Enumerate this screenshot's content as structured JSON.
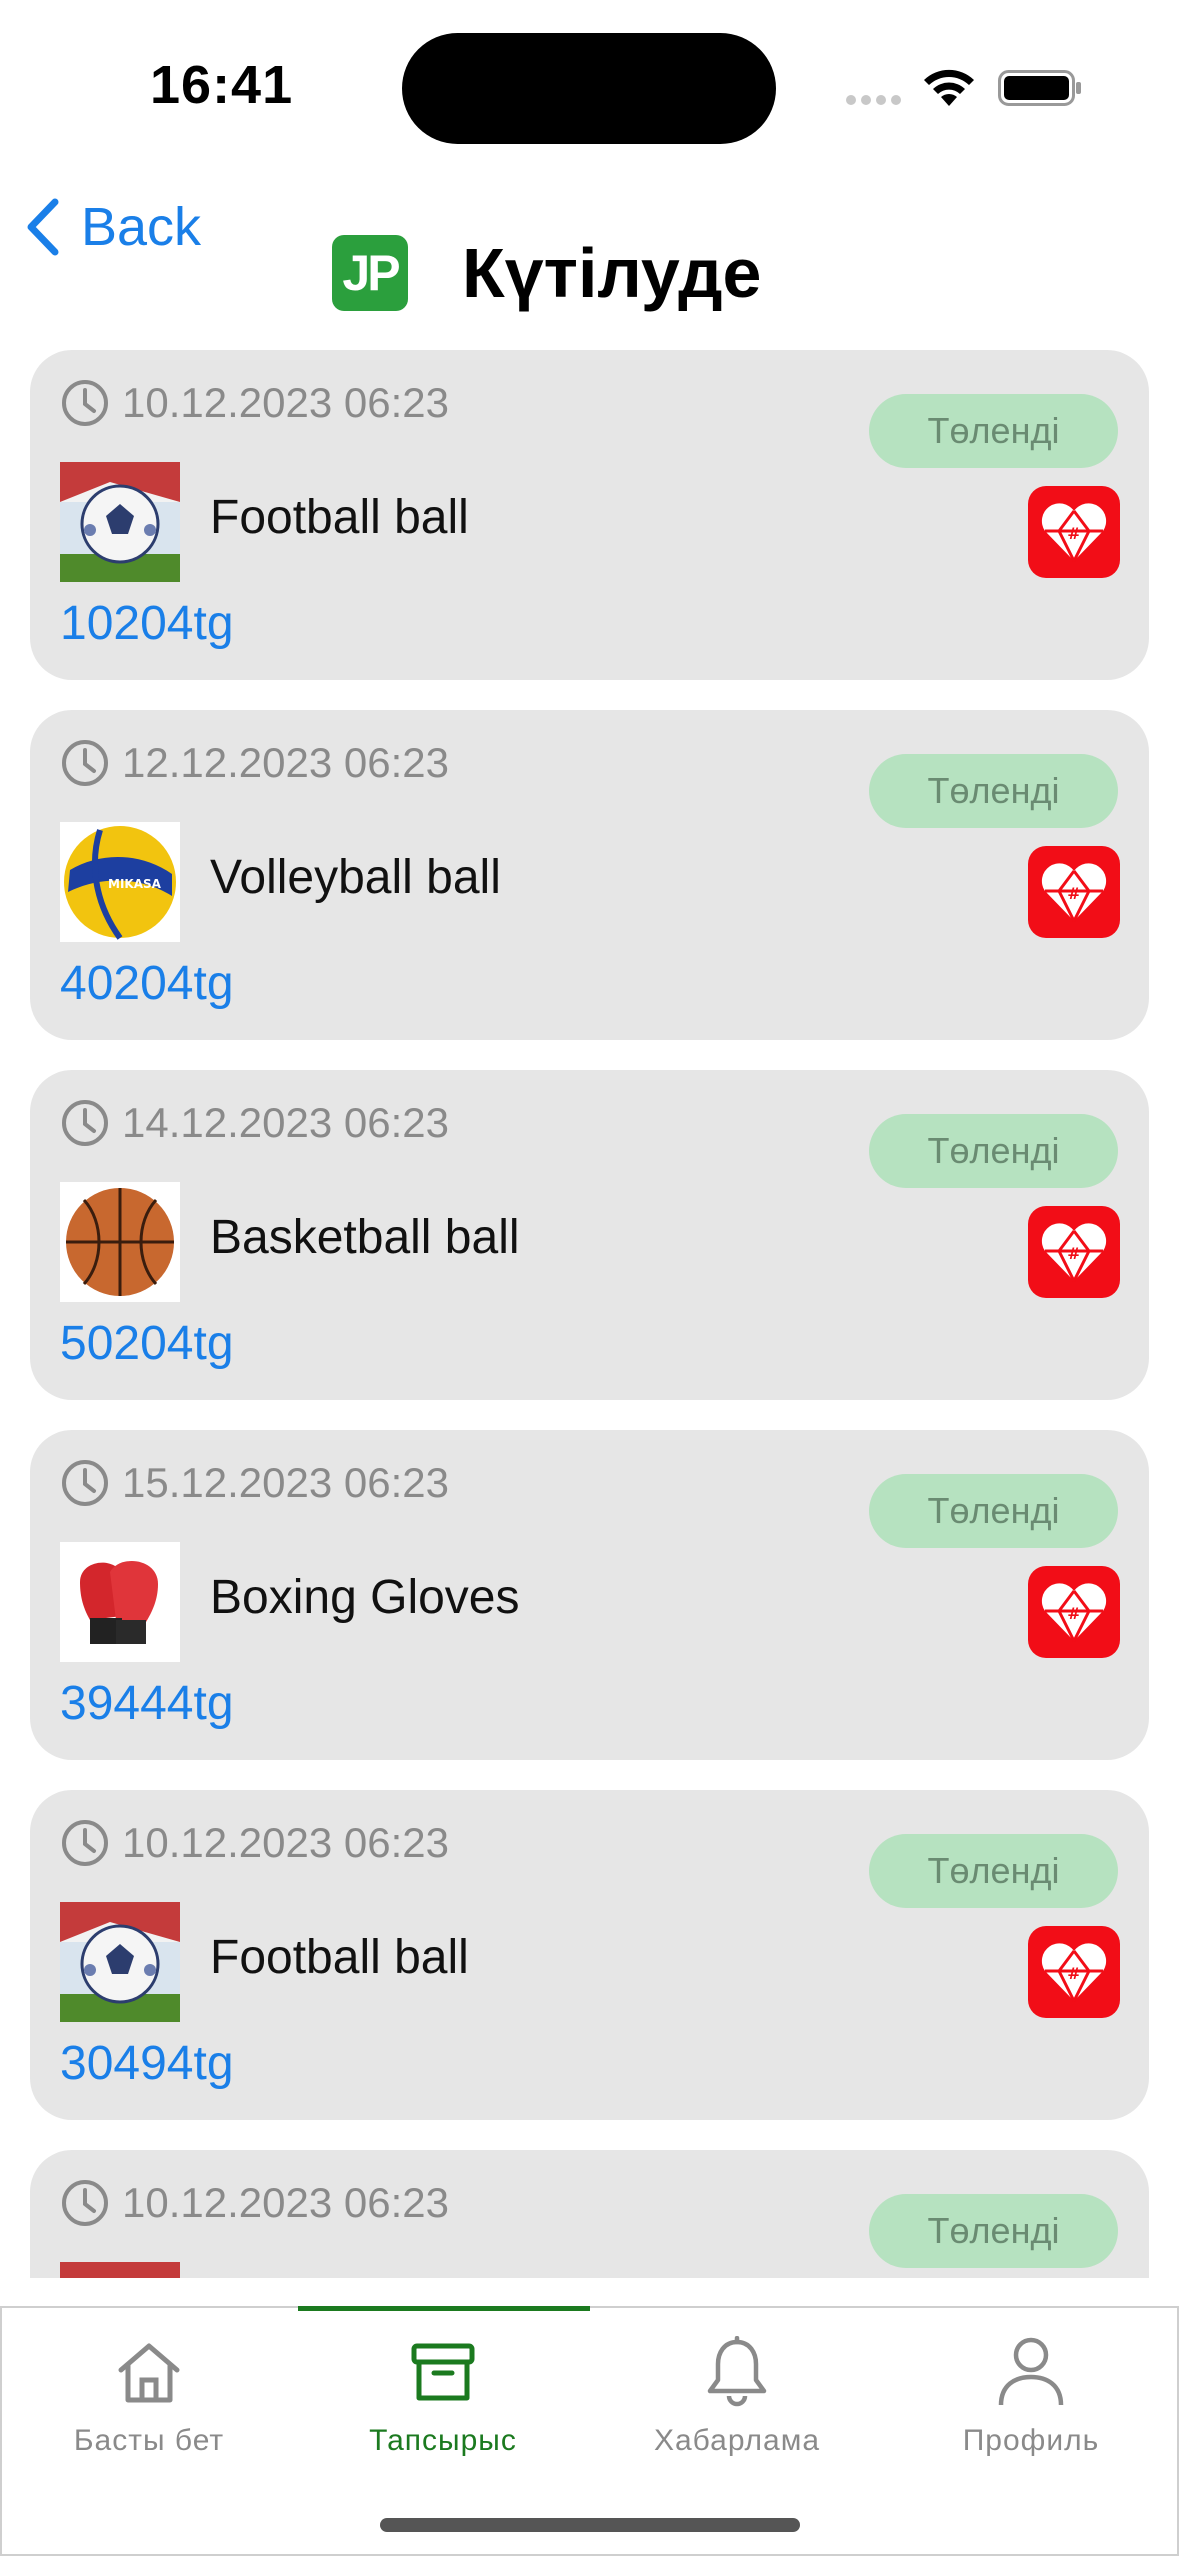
{
  "status_bar": {
    "time": "16:41"
  },
  "header": {
    "back_label": "Back",
    "logo_text": "JP",
    "title": "Күтілуде"
  },
  "colors": {
    "accent": "#1a7fe8",
    "brand_green": "#2b9f3d",
    "active_tab": "#1b7a1f",
    "pill_bg": "#b6e2c0",
    "app_icon_red": "#f20d17"
  },
  "orders": [
    {
      "date": "10.12.2023 06:23",
      "status": "Төленді",
      "name": "Football ball",
      "price": "10204tg",
      "thumb": "football"
    },
    {
      "date": "12.12.2023 06:23",
      "status": "Төленді",
      "name": "Volleyball ball",
      "price": "40204tg",
      "thumb": "volleyball"
    },
    {
      "date": "14.12.2023 06:23",
      "status": "Төленді",
      "name": "Basketball ball",
      "price": "50204tg",
      "thumb": "basketball"
    },
    {
      "date": "15.12.2023 06:23",
      "status": "Төленді",
      "name": "Boxing Gloves",
      "price": "39444tg",
      "thumb": "boxing-gloves"
    },
    {
      "date": "10.12.2023 06:23",
      "status": "Төленді",
      "name": "Football ball",
      "price": "30494tg",
      "thumb": "football"
    },
    {
      "date": "10.12.2023 06:23",
      "status": "Төленді",
      "name": "",
      "price": "",
      "thumb": "football"
    }
  ],
  "tabs": [
    {
      "label": "Басты бет",
      "icon": "home-icon"
    },
    {
      "label": "Тапсырыс",
      "icon": "archive-box-icon"
    },
    {
      "label": "Хабарлама",
      "icon": "bell-icon"
    },
    {
      "label": "Профиль",
      "icon": "person-icon"
    }
  ],
  "active_tab": 1
}
